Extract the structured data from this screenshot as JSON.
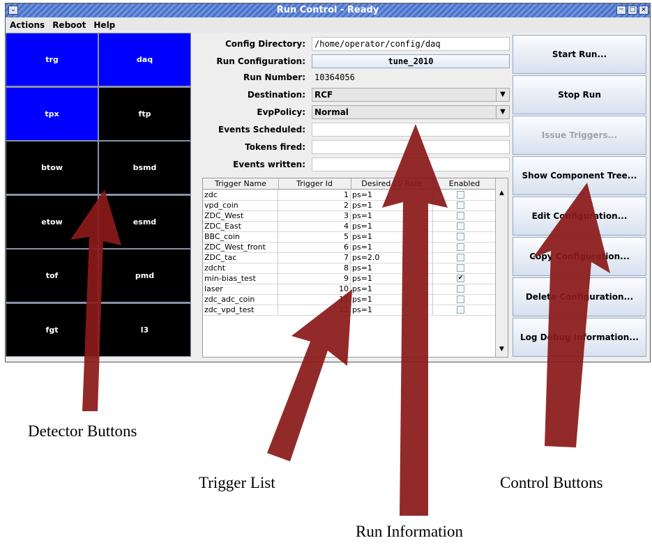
{
  "window": {
    "title": "Run Control - Ready",
    "menu": [
      "Actions",
      "Reboot",
      "Help"
    ]
  },
  "detectors": [
    {
      "name": "trg",
      "color": "#0000ff"
    },
    {
      "name": "daq",
      "color": "#0000ff"
    },
    {
      "name": "tpx",
      "color": "#0000ff"
    },
    {
      "name": "ftp",
      "color": "#000000"
    },
    {
      "name": "btow",
      "color": "#000000"
    },
    {
      "name": "bsmd",
      "color": "#000000"
    },
    {
      "name": "etow",
      "color": "#000000"
    },
    {
      "name": "esmd",
      "color": "#000000"
    },
    {
      "name": "tof",
      "color": "#000000"
    },
    {
      "name": "pmd",
      "color": "#000000"
    },
    {
      "name": "fgt",
      "color": "#000000"
    },
    {
      "name": "l3",
      "color": "#000000"
    }
  ],
  "run_info": {
    "config_directory_label": "Config Directory:",
    "config_directory": "/home/operator/config/daq",
    "run_configuration_label": "Run Configuration:",
    "run_configuration": "tune_2010",
    "run_number_label": "Run Number:",
    "run_number": "10364056",
    "destination_label": "Destination:",
    "destination": "RCF",
    "evppolicy_label": "EvpPolicy:",
    "evppolicy": "Normal",
    "events_scheduled_label": "Events Scheduled:",
    "events_scheduled": "",
    "tokens_fired_label": "Tokens fired:",
    "tokens_fired": "",
    "events_written_label": "Events written:",
    "events_written": ""
  },
  "trigger_table": {
    "columns": [
      "Trigger Name",
      "Trigger Id",
      "Desired L0 Rate",
      "Enabled"
    ],
    "rows": [
      {
        "name": "zdc",
        "id": "1",
        "rate": "ps=1",
        "enabled": false
      },
      {
        "name": "vpd_coin",
        "id": "2",
        "rate": "ps=1",
        "enabled": false
      },
      {
        "name": "ZDC_West",
        "id": "3",
        "rate": "ps=1",
        "enabled": false
      },
      {
        "name": "ZDC_East",
        "id": "4",
        "rate": "ps=1",
        "enabled": false
      },
      {
        "name": "BBC_coin",
        "id": "5",
        "rate": "ps=1",
        "enabled": false
      },
      {
        "name": "ZDC_West_front",
        "id": "6",
        "rate": "ps=1",
        "enabled": false
      },
      {
        "name": "ZDC_tac",
        "id": "7",
        "rate": "ps=2.0",
        "enabled": false
      },
      {
        "name": "zdcht",
        "id": "8",
        "rate": "ps=1",
        "enabled": false
      },
      {
        "name": "min-bias_test",
        "id": "9",
        "rate": "ps=1",
        "enabled": true
      },
      {
        "name": "laser",
        "id": "10",
        "rate": "ps=1",
        "enabled": false
      },
      {
        "name": "zdc_adc_coin",
        "id": "11",
        "rate": "ps=1",
        "enabled": false
      },
      {
        "name": "zdc_vpd_test",
        "id": "12",
        "rate": "ps=1",
        "enabled": false
      }
    ]
  },
  "controls": [
    {
      "label": "Start Run...",
      "enabled": true
    },
    {
      "label": "Stop Run",
      "enabled": true
    },
    {
      "label": "Issue Triggers...",
      "enabled": false
    },
    {
      "label": "Show Component Tree...",
      "enabled": true
    },
    {
      "label": "Edit Configuration...",
      "enabled": true
    },
    {
      "label": "Copy Configuration...",
      "enabled": true
    },
    {
      "label": "Delete Configuration...",
      "enabled": true
    },
    {
      "label": "Log Debug Information...",
      "enabled": true
    }
  ],
  "annotations": {
    "detector_buttons": "Detector Buttons",
    "trigger_list": "Trigger List",
    "control_buttons": "Control Buttons",
    "run_information": "Run Information",
    "arrow_color": "#8b1a1a"
  }
}
